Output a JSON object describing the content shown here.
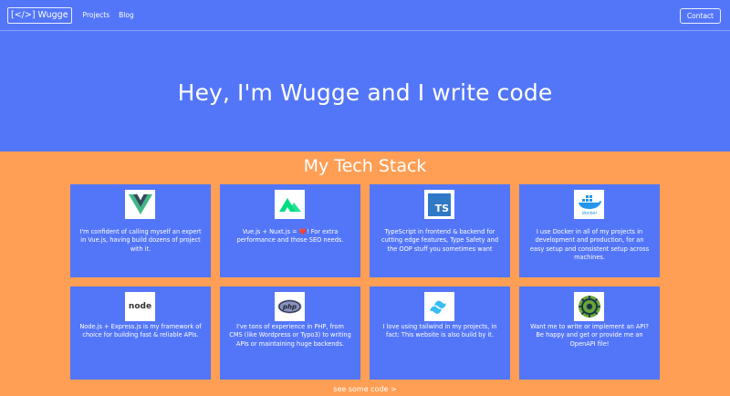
{
  "nav": {
    "logo": "[</>] Wugge",
    "links": [
      "Projects",
      "Blog"
    ],
    "contact": "Contact"
  },
  "hero": {
    "title": "Hey, I'm Wugge and I write code"
  },
  "tech": {
    "title": "My Tech Stack",
    "cards": [
      {
        "icon": "vue-icon",
        "text": "I'm confident of calling myself an expert in Vue.js, having build dozens of project with it."
      },
      {
        "icon": "nuxt-icon",
        "text": "Vue.js + Nuxt.js = ❤️! For extra performance and those SEO needs."
      },
      {
        "icon": "typescript-icon",
        "text": "TypeScript in frontend & backend for cutting edge features, Type Safety and the OOP stuff you sometimes want"
      },
      {
        "icon": "docker-icon",
        "text": "I use Docker in all of my projects in development and production, for an easy setup and consistent setup across machines."
      },
      {
        "icon": "node-icon",
        "text": "Node.js + Express.js is my framework of choice for building fast & reliable APIs."
      },
      {
        "icon": "php-icon",
        "text": "I've tons of experience in PHP, from CMS (like Wordpress or Typo3) to writing APIs or maintaining huge backends."
      },
      {
        "icon": "tailwind-icon",
        "text": "I love using tailwind in my projects, in fact: This website is also build by it."
      },
      {
        "icon": "openapi-icon",
        "text": "Want me to write or implement an API? Be happy and get or provide me an OpenAPI file!"
      }
    ]
  },
  "icons": {
    "ts_label": "TS",
    "node_label": "node",
    "php_label": "php",
    "docker_label": "docker"
  },
  "footer": {
    "link": "see some code >"
  },
  "colors": {
    "primary": "#5376f9",
    "background": "#ff9f55",
    "vue": "#41b883",
    "vue_dark": "#34495e",
    "nuxt": "#00dc82",
    "ts": "#3178c6",
    "tailwind": "#38bdf8",
    "openapi": "#6ba539"
  }
}
